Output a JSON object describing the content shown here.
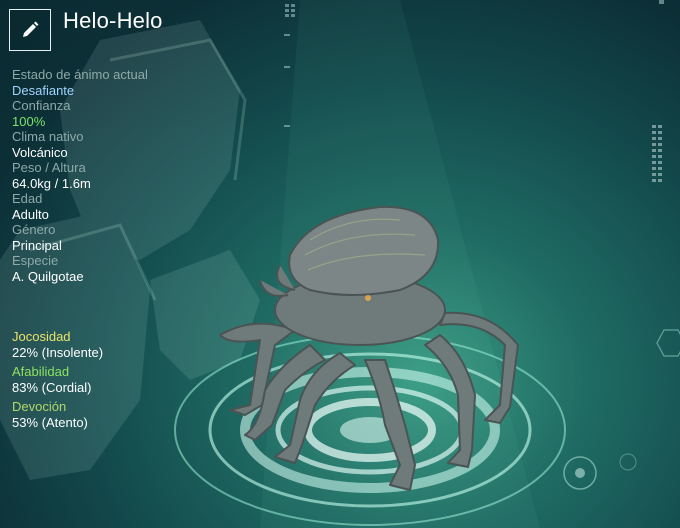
{
  "creature": {
    "name": "Helo-Helo"
  },
  "stats": [
    {
      "label": "Estado de ánimo actual",
      "value": "Desafiante",
      "style": "mood"
    },
    {
      "label": "Confianza",
      "value": "100%",
      "style": "green"
    },
    {
      "label": "Clima nativo",
      "value": "Volcánico",
      "style": ""
    },
    {
      "label": "Peso / Altura",
      "value": "64.0kg / 1.6m",
      "style": ""
    },
    {
      "label": "Edad",
      "value": "Adulto",
      "style": ""
    },
    {
      "label": "Género",
      "value": "Principal",
      "style": ""
    },
    {
      "label": "Especie",
      "value": "A. Quilgotae",
      "style": ""
    }
  ],
  "traits": [
    {
      "label": "Jocosidad",
      "value": "22% (Insolente)",
      "color": "#e8e26a"
    },
    {
      "label": "Afabilidad",
      "value": "83% (Cordial)",
      "color": "#8ee35f"
    },
    {
      "label": "Devoción",
      "value": "53% (Atento)",
      "color": "#b0d86a"
    }
  ],
  "icons": {
    "edit": "pencil-icon"
  }
}
